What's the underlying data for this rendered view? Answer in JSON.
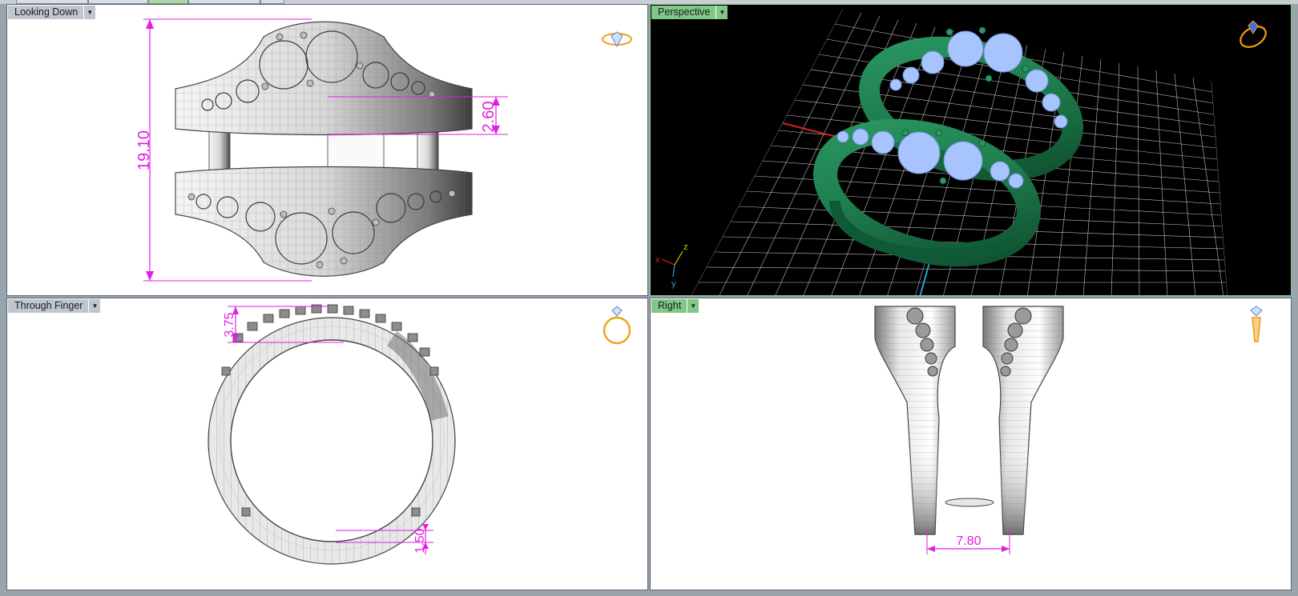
{
  "viewports": {
    "top_left": {
      "label": "Looking Down",
      "active": false
    },
    "top_right": {
      "label": "Perspective",
      "active": true
    },
    "bottom_left": {
      "label": "Through Finger",
      "active": false
    },
    "bottom_right": {
      "label": "Right",
      "active": false
    }
  },
  "dimensions": {
    "ring_height": "19.10",
    "band_width": "2.60",
    "top_thickness": "3.75",
    "bottom_thickness": "1.50",
    "gap_width": "7.80"
  },
  "axis": {
    "x": "x",
    "y": "y",
    "z": "z"
  },
  "colors": {
    "accent_active_label": "#7fc887",
    "inactive_label": "#bfc6cf",
    "dimension": "#e21ee2",
    "render_metal": "#1e7a4c",
    "render_stone": "#a8c4ff",
    "grid": "#c8c8c8",
    "view_icon": "#f0a010"
  },
  "icons": [
    "ring-top-view-icon",
    "ring-perspective-icon",
    "ring-front-view-icon",
    "ring-side-view-icon",
    "chevron-down-icon"
  ]
}
